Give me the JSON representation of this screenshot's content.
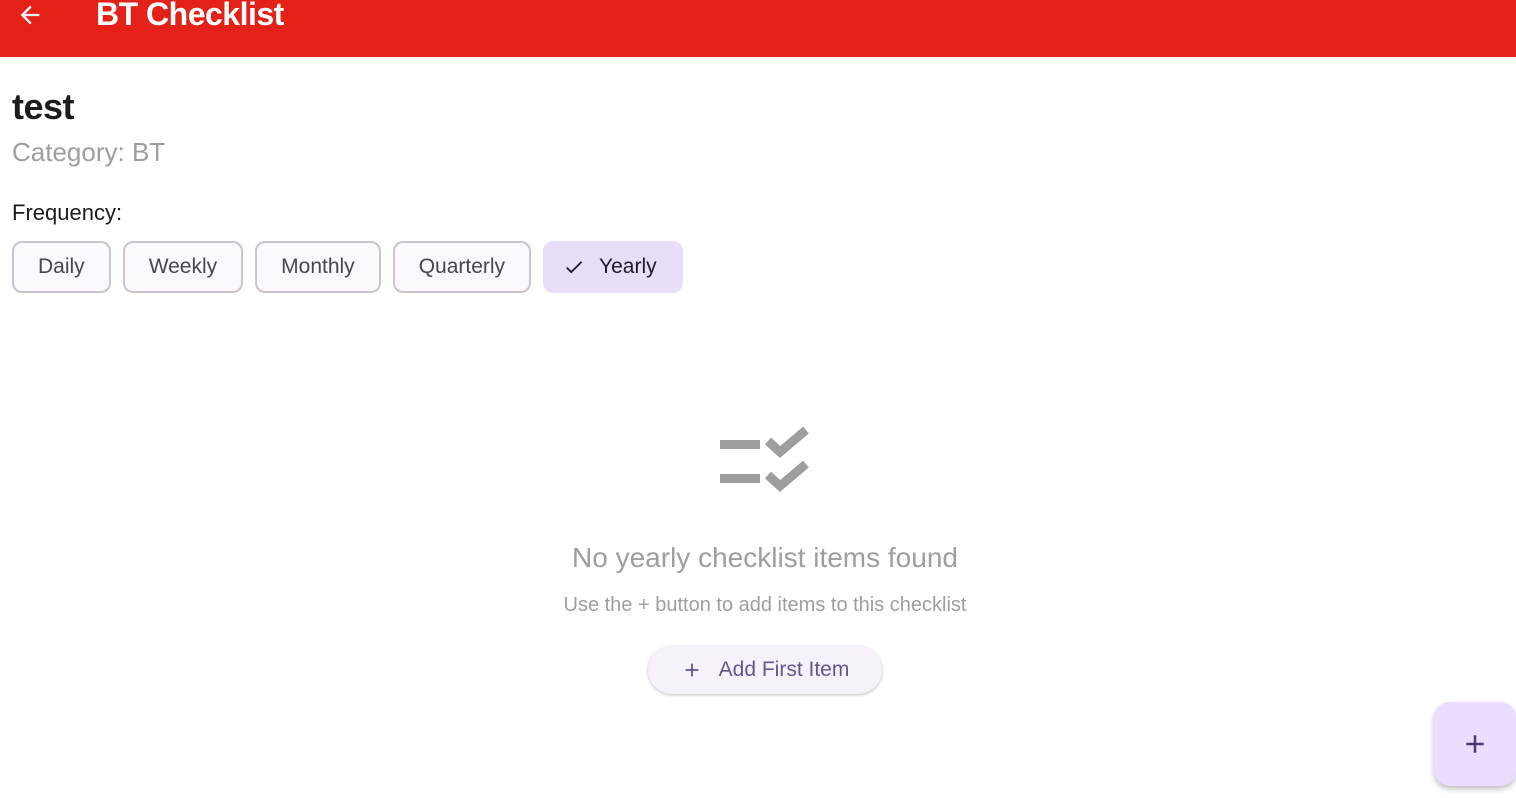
{
  "appbar": {
    "title": "BT Checklist",
    "back_icon": "arrow-back-icon",
    "color": "#e32118"
  },
  "checklist": {
    "name": "test",
    "category": "Category: BT"
  },
  "frequency": {
    "label": "Frequency:",
    "options": [
      {
        "label": "Daily",
        "selected": false
      },
      {
        "label": "Weekly",
        "selected": false
      },
      {
        "label": "Monthly",
        "selected": false
      },
      {
        "label": "Quarterly",
        "selected": false
      },
      {
        "label": "Yearly",
        "selected": true
      }
    ],
    "selected_icon": "check-icon"
  },
  "empty_state": {
    "icon": "checklist-icon",
    "title": "No yearly checklist items found",
    "subtitle": "Use the + button to add items to this checklist",
    "button_label": "Add First Item",
    "button_icon": "plus-icon"
  },
  "fab": {
    "icon": "plus-icon",
    "color": "#eaddff"
  }
}
